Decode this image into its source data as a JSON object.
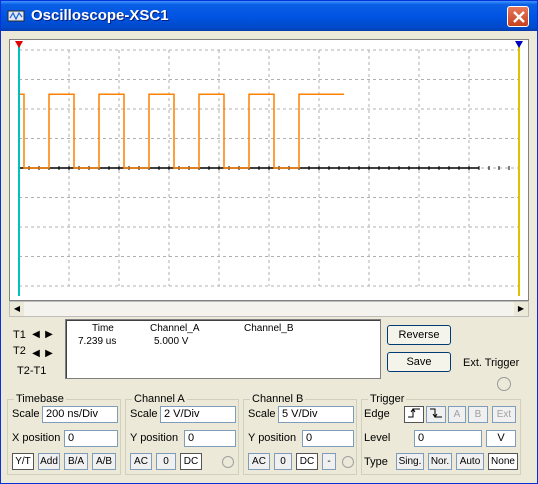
{
  "window": {
    "title": "Oscilloscope-XSC1"
  },
  "cursor_labels": {
    "t1": "T1",
    "t2": "T2",
    "t2_t1": "T2-T1"
  },
  "readout": {
    "headers": [
      "Time",
      "Channel_A",
      "Channel_B"
    ],
    "row1": {
      "time": "7.239 us",
      "channel_a": "5.000 V",
      "channel_b": ""
    }
  },
  "buttons": {
    "reverse": "Reverse",
    "save": "Save",
    "ext_trigger": "Ext. Trigger"
  },
  "timebase": {
    "title": "Timebase",
    "scale_label": "Scale",
    "scale_value": "200 ns/Div",
    "xpos_label": "X position",
    "xpos_value": "0",
    "modes": [
      "Y/T",
      "Add",
      "B/A",
      "A/B"
    ],
    "selected_mode": "Y/T"
  },
  "channel_a": {
    "title": "Channel A",
    "scale_label": "Scale",
    "scale_value": "2  V/Div",
    "ypos_label": "Y position",
    "ypos_value": "0",
    "coupling": [
      "AC",
      "0",
      "DC"
    ],
    "selected_coupling": "DC"
  },
  "channel_b": {
    "title": "Channel B",
    "scale_label": "Scale",
    "scale_value": "5  V/Div",
    "ypos_label": "Y position",
    "ypos_value": "0",
    "coupling": [
      "AC",
      "0",
      "DC",
      "-"
    ],
    "selected_coupling": "DC"
  },
  "trigger": {
    "title": "Trigger",
    "edge_label": "Edge",
    "edge_buttons": [
      "rising-edge",
      "falling-edge",
      "A",
      "B",
      "Ext"
    ],
    "level_label": "Level",
    "level_value": "0",
    "level_unit": "V",
    "type_label": "Type",
    "types": [
      "Sing.",
      "Nor.",
      "Auto",
      "None"
    ],
    "selected_type": "None"
  },
  "colors": {
    "trace_a": "#ff8000",
    "trace_b": "#000000",
    "cursor_t1": "#00c0c0",
    "cursor_t2": "#e0c000",
    "grid": "#b0b0b0"
  },
  "chart_data": {
    "type": "line",
    "series": [
      {
        "name": "Channel_A",
        "x": [
          0,
          0.1,
          0.1,
          0.6,
          0.6,
          1.1,
          1.1,
          1.6,
          1.6,
          2.1,
          2.1,
          2.6,
          2.6,
          3.1,
          3.1,
          3.6,
          3.6,
          4.1,
          4.1,
          4.6,
          4.6,
          5.1,
          5.1,
          5.6,
          5.6,
          6.1,
          6.1,
          6.5
        ],
        "y": [
          5,
          5,
          0,
          0,
          5,
          5,
          0,
          0,
          5,
          5,
          0,
          0,
          5,
          5,
          0,
          0,
          5,
          5,
          0,
          0,
          5,
          5,
          0,
          0,
          5,
          5,
          5,
          5
        ]
      },
      {
        "name": "Channel_B",
        "x": [
          0,
          9.2
        ],
        "y": [
          0,
          0
        ]
      }
    ],
    "x_divisions": 10,
    "y_divisions": 8,
    "grid": true
  }
}
